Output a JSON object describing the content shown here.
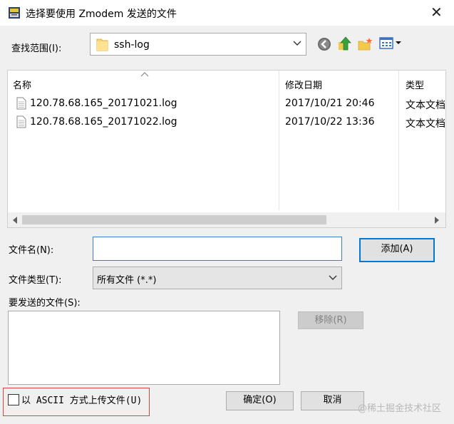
{
  "window": {
    "title": "选择要使用 Zmodem 发送的文件",
    "icon": "zmodem-app-icon",
    "close_label": "✕"
  },
  "look_in": {
    "label": "查找范围(I):",
    "value": "ssh-log",
    "icon": "folder-icon"
  },
  "toolbar": {
    "icons": [
      "back-arrow-icon",
      "up-folder-icon",
      "new-folder-icon",
      "view-menu-icon"
    ]
  },
  "file_list": {
    "columns": [
      "名称",
      "修改日期",
      "类型"
    ],
    "rows": [
      {
        "name": "120.78.68.165_20171021.log",
        "modified": "2017/10/21 20:46",
        "type": "文本文档"
      },
      {
        "name": "120.78.68.165_20171022.log",
        "modified": "2017/10/22 13:36",
        "type": "文本文档"
      }
    ]
  },
  "filename": {
    "label": "文件名(N):",
    "value": "",
    "add_label": "添加(A)"
  },
  "filetype": {
    "label": "文件类型(T):",
    "value": "所有文件  (*.*)"
  },
  "send_list": {
    "label": "要发送的文件(S):",
    "remove_label": "移除(R)"
  },
  "ascii": {
    "label": "以 ASCII 方式上传文件(U)",
    "checked": false
  },
  "buttons": {
    "ok_label": "确定(O)",
    "cancel_label": "取消"
  },
  "watermark": "@稀土掘金技术社区",
  "colors": {
    "accent": "#0078d7",
    "highlight_box": "#d9453f",
    "disabled_text": "#838383"
  }
}
